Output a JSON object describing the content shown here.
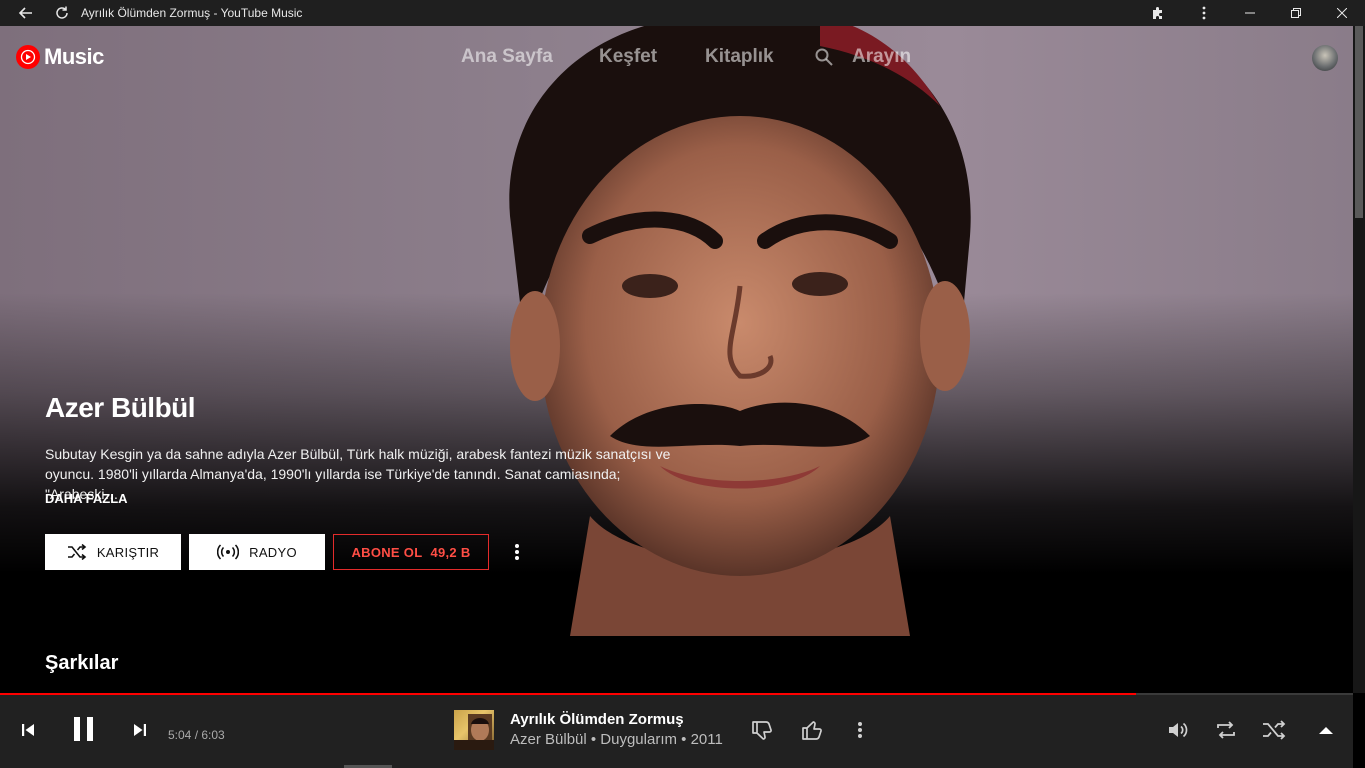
{
  "window": {
    "title": "Ayrılık Ölümden Zormuş - YouTube Music"
  },
  "app": {
    "logo_text": "Music"
  },
  "nav": {
    "home": "Ana Sayfa",
    "explore": "Keşfet",
    "library": "Kitaplık",
    "search": "Arayın"
  },
  "artist": {
    "name": "Azer Bülbül",
    "description": "Subutay Kesgin ya da sahne adıyla Azer Bülbül, Türk halk müziği, arabesk fantezi müzik sanatçısı ve oyuncu. 1980'li yıllarda Almanya'da, 1990'lı yıllarda ise Türkiye'de tanındı. Sanat camiasında; \"Arabeski…",
    "more_label": "DAHA FAZLA",
    "shuffle_label": "KARIŞTIR",
    "radio_label": "RADYO",
    "subscribe_label": "ABONE OL",
    "subscriber_count": "49,2 B"
  },
  "sections": {
    "songs_title": "Şarkılar"
  },
  "player": {
    "time": "5:04 / 6:03",
    "progress": 0.8393,
    "track_title": "Ayrılık Ölümden Zormuş",
    "track_subtitle": "Azer Bülbül • Duygularım • 2011"
  },
  "colors": {
    "accent": "#ff0000",
    "subscribe": "#ff4e45",
    "player_bg": "#212121",
    "titlebar_bg": "#1f1f1f"
  }
}
